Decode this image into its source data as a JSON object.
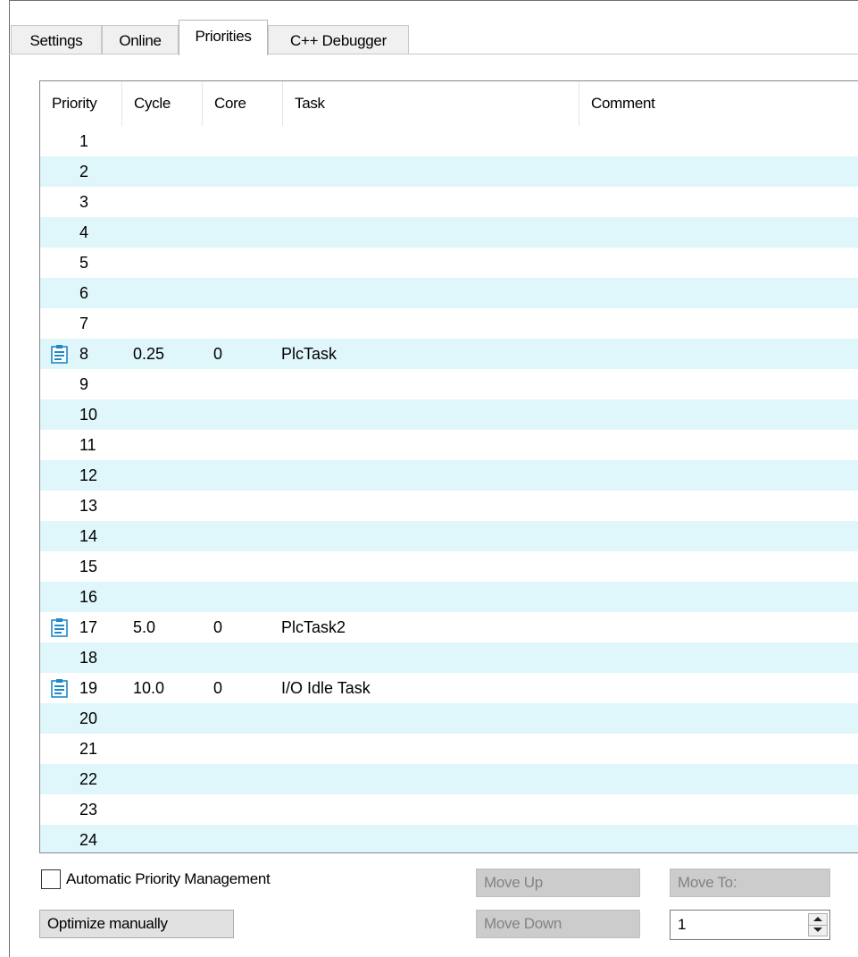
{
  "tabs": [
    {
      "label": "Settings",
      "active": false
    },
    {
      "label": "Online",
      "active": false
    },
    {
      "label": "Priorities",
      "active": true
    },
    {
      "label": "C++ Debugger",
      "active": false
    }
  ],
  "grid": {
    "columns": [
      "Priority",
      "Cycle",
      "Core",
      "Task",
      "Comment"
    ],
    "rows": [
      {
        "priority": "1",
        "cycle": "",
        "core": "",
        "task": "",
        "comment": "",
        "icon": ""
      },
      {
        "priority": "2",
        "cycle": "",
        "core": "",
        "task": "",
        "comment": "",
        "icon": ""
      },
      {
        "priority": "3",
        "cycle": "",
        "core": "",
        "task": "",
        "comment": "",
        "icon": ""
      },
      {
        "priority": "4",
        "cycle": "",
        "core": "",
        "task": "",
        "comment": "",
        "icon": ""
      },
      {
        "priority": "5",
        "cycle": "",
        "core": "",
        "task": "",
        "comment": "",
        "icon": ""
      },
      {
        "priority": "6",
        "cycle": "",
        "core": "",
        "task": "",
        "comment": "",
        "icon": ""
      },
      {
        "priority": "7",
        "cycle": "",
        "core": "",
        "task": "",
        "comment": "",
        "icon": ""
      },
      {
        "priority": "8",
        "cycle": "0.25",
        "core": "0",
        "task": "PlcTask",
        "comment": "",
        "icon": "task-icon"
      },
      {
        "priority": "9",
        "cycle": "",
        "core": "",
        "task": "",
        "comment": "",
        "icon": ""
      },
      {
        "priority": "10",
        "cycle": "",
        "core": "",
        "task": "",
        "comment": "",
        "icon": ""
      },
      {
        "priority": "11",
        "cycle": "",
        "core": "",
        "task": "",
        "comment": "",
        "icon": ""
      },
      {
        "priority": "12",
        "cycle": "",
        "core": "",
        "task": "",
        "comment": "",
        "icon": ""
      },
      {
        "priority": "13",
        "cycle": "",
        "core": "",
        "task": "",
        "comment": "",
        "icon": ""
      },
      {
        "priority": "14",
        "cycle": "",
        "core": "",
        "task": "",
        "comment": "",
        "icon": ""
      },
      {
        "priority": "15",
        "cycle": "",
        "core": "",
        "task": "",
        "comment": "",
        "icon": ""
      },
      {
        "priority": "16",
        "cycle": "",
        "core": "",
        "task": "",
        "comment": "",
        "icon": ""
      },
      {
        "priority": "17",
        "cycle": "5.0",
        "core": "0",
        "task": "PlcTask2",
        "comment": "",
        "icon": "task-icon"
      },
      {
        "priority": "18",
        "cycle": "",
        "core": "",
        "task": "",
        "comment": "",
        "icon": ""
      },
      {
        "priority": "19",
        "cycle": "10.0",
        "core": "0",
        "task": "I/O Idle Task",
        "comment": "",
        "icon": "task-icon"
      },
      {
        "priority": "20",
        "cycle": "",
        "core": "",
        "task": "",
        "comment": "",
        "icon": ""
      },
      {
        "priority": "21",
        "cycle": "",
        "core": "",
        "task": "",
        "comment": "",
        "icon": ""
      },
      {
        "priority": "22",
        "cycle": "",
        "core": "",
        "task": "",
        "comment": "",
        "icon": ""
      },
      {
        "priority": "23",
        "cycle": "",
        "core": "",
        "task": "",
        "comment": "",
        "icon": ""
      },
      {
        "priority": "24",
        "cycle": "",
        "core": "",
        "task": "",
        "comment": "",
        "icon": ""
      }
    ]
  },
  "controls": {
    "auto_priority_label": "Automatic Priority Management",
    "auto_priority_checked": false,
    "optimize_label": "Optimize manually",
    "move_up_label": "Move Up",
    "move_down_label": "Move Down",
    "move_to_label": "Move To:",
    "move_to_value": "1"
  },
  "colors": {
    "alt_row": "#dff6fb",
    "task_icon": "#1e88c8",
    "disabled_button": "#cccccc"
  }
}
